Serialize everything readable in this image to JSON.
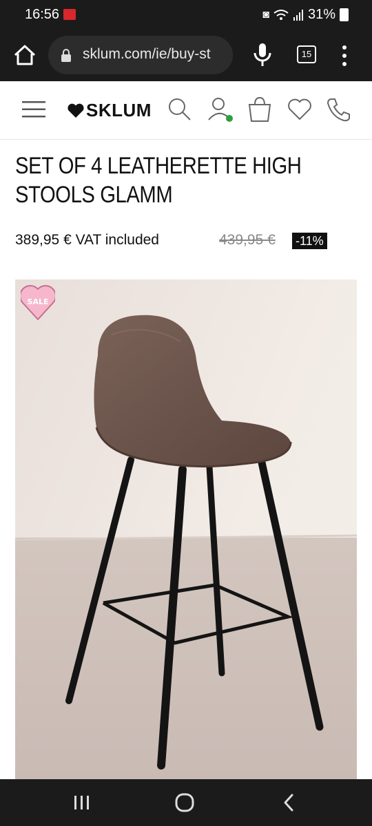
{
  "status": {
    "time": "16:56",
    "battery": "31%"
  },
  "browser": {
    "url": "sklum.com/ie/buy-st",
    "tab_count": "15"
  },
  "site": {
    "logo": "SKLUM"
  },
  "product": {
    "title": "SET OF 4 LEATHERETTE HIGH STOOLS GLAMM",
    "price": "389,95 € VAT included",
    "old_price": "439,95 €",
    "discount": "-11%",
    "badge": "SALE"
  },
  "colors": {
    "accent_green": "#2e9e3f",
    "badge_pink": "#f6b7cc",
    "seat_brown": "#6b544b"
  },
  "icons": {
    "header": [
      "menu-icon",
      "search-icon",
      "user-icon",
      "bag-icon",
      "heart-icon",
      "phone-icon"
    ],
    "browser": [
      "home-icon",
      "lock-icon",
      "mic-icon",
      "tabs-icon",
      "more-icon"
    ],
    "nav": [
      "recents-icon",
      "home-icon",
      "back-icon"
    ]
  }
}
